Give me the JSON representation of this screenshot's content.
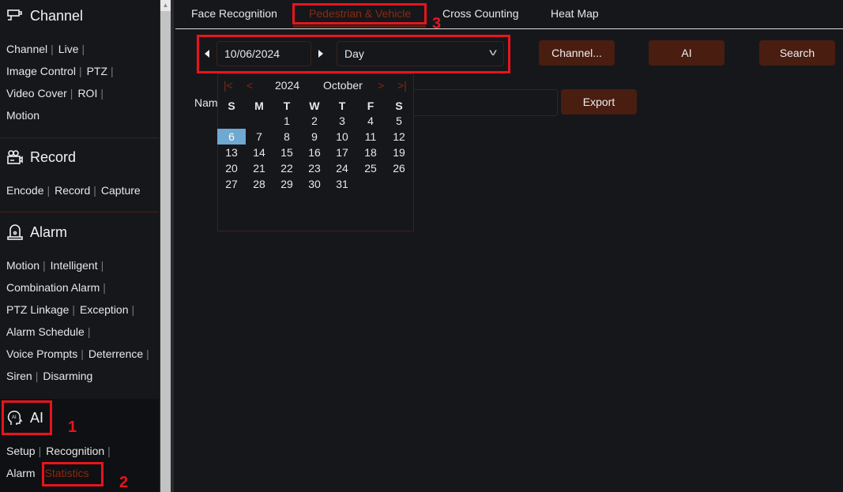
{
  "sidebar": {
    "channel": {
      "title": "Channel",
      "links": [
        "Channel",
        "Live",
        "Image Control",
        "PTZ",
        "Video Cover",
        "ROI",
        "Motion"
      ]
    },
    "record": {
      "title": "Record",
      "links": [
        "Encode",
        "Record",
        "Capture"
      ]
    },
    "alarm": {
      "title": "Alarm",
      "links": [
        "Motion",
        "Intelligent",
        "Combination Alarm",
        "PTZ Linkage",
        "Exception",
        "Alarm Schedule",
        "Voice Prompts",
        "Deterrence",
        "Siren",
        "Disarming"
      ]
    },
    "ai": {
      "title": "AI",
      "icon_text": "AI",
      "links": [
        "Setup",
        "Recognition",
        "Alarm",
        "Statistics"
      ],
      "active": "Statistics"
    }
  },
  "tabs": [
    "Face Recognition",
    "Pedestrian & Vehicle",
    "Cross Counting",
    "Heat Map"
  ],
  "active_tab": "Pedestrian & Vehicle",
  "toolbar": {
    "date": "10/06/2024",
    "period": "Day",
    "channel_btn": "Channel...",
    "ai_btn": "AI",
    "search_btn": "Search",
    "name_label": "Name",
    "export_btn": "Export"
  },
  "calendar": {
    "year": "2024",
    "month": "October",
    "weekdays": [
      "S",
      "M",
      "T",
      "W",
      "T",
      "F",
      "S"
    ],
    "first_weekday": 2,
    "days": 31,
    "selected": 6
  },
  "annotations": [
    "1",
    "2",
    "3"
  ],
  "colors": {
    "accent": "#4a1d11",
    "active_text": "#8a2a10",
    "selected_day": "#6fa8d0",
    "annotation": "#e8141c"
  }
}
